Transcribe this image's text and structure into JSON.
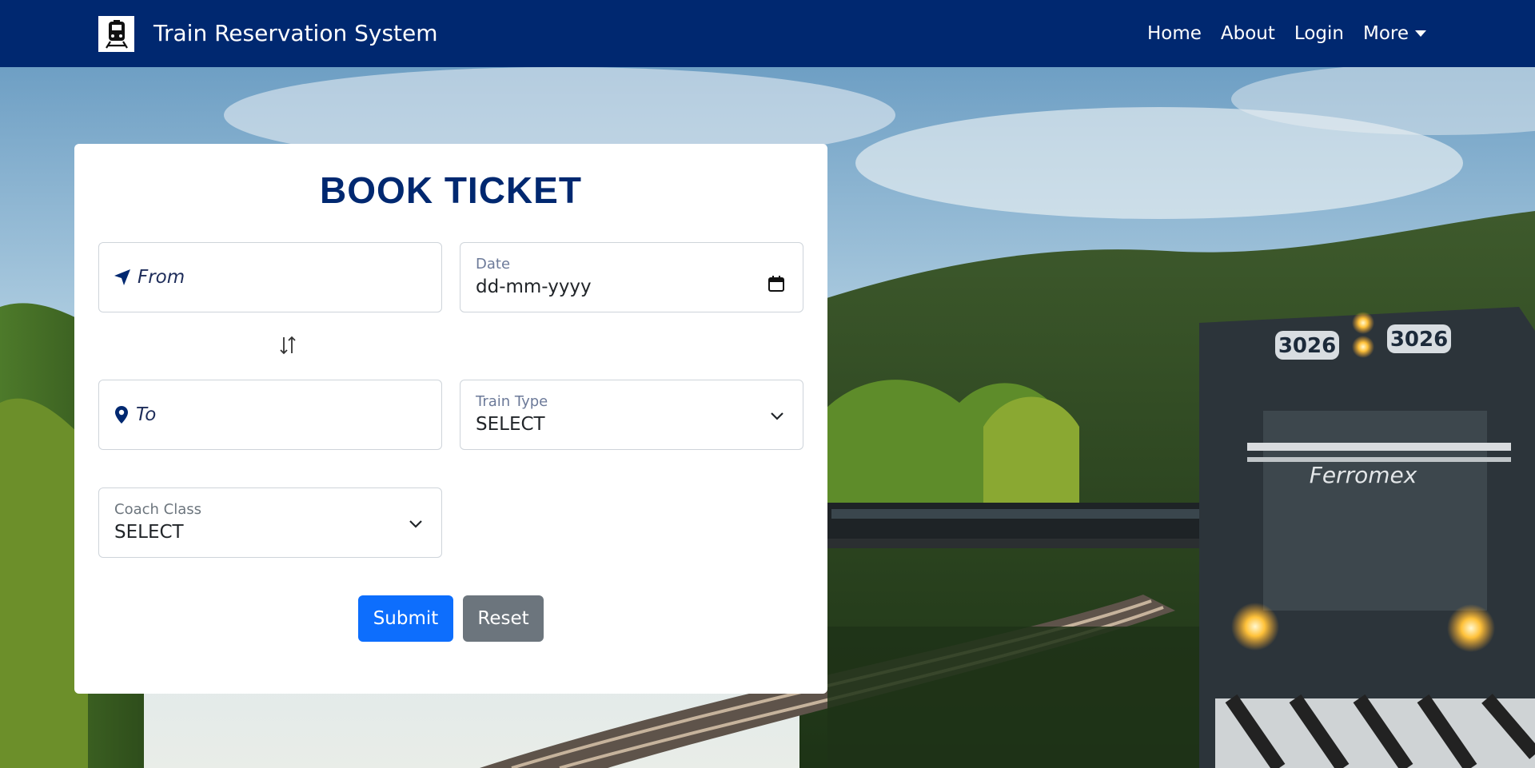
{
  "navbar": {
    "title": "Train Reservation System",
    "logo_icon": "train-icon",
    "background": "#002870",
    "links": [
      "Home",
      "About",
      "Login"
    ],
    "more_label": "More"
  },
  "form": {
    "title": "BOOK TICKET",
    "from": {
      "placeholder": "From",
      "icon": "location-arrow-icon"
    },
    "to": {
      "placeholder": "To",
      "icon": "map-pin-icon"
    },
    "swap_icon": "swap-arrows-icon",
    "date": {
      "label": "Date",
      "value": "dd-mm-yyyy",
      "icon": "calendar-icon"
    },
    "train_type": {
      "label": "Train Type",
      "value": "SELECT"
    },
    "coach_class": {
      "label": "Coach Class",
      "value": "SELECT"
    },
    "submit_label": "Submit",
    "reset_label": "Reset"
  },
  "background": {
    "locomotive_number": "3026",
    "locomotive_brand": "Ferromex"
  },
  "colors": {
    "primary": "#0d6efd",
    "secondary": "#6c757d",
    "brand_navy": "#002870"
  }
}
